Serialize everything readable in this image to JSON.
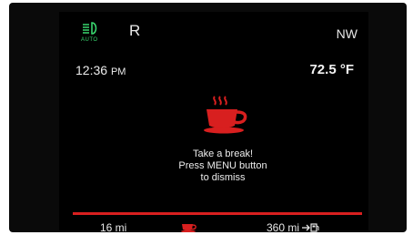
{
  "header": {
    "gear": "R",
    "compass": "NW",
    "auto_label": "AUTO"
  },
  "info": {
    "time": "12:36",
    "time_suffix": "PM",
    "temperature": "72.5 °F"
  },
  "alert": {
    "line1": "Take a break!",
    "line2": "Press MENU button",
    "line3": "to dismiss"
  },
  "status": {
    "range_left": "16 mi",
    "range_right": "360 mi"
  },
  "colors": {
    "alert_red": "#d81f1f",
    "headlamp_green": "#39d66e"
  },
  "icons": {
    "headlamp": "auto-headlamp-icon",
    "cup": "coffee-cup-icon",
    "fuel": "fuel-pump-icon"
  }
}
